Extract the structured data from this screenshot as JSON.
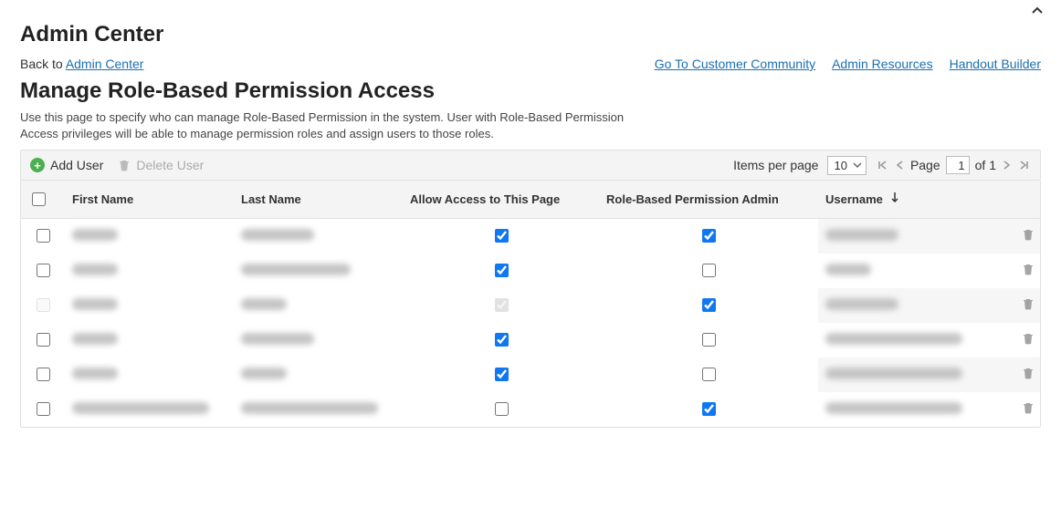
{
  "header": {
    "title": "Admin Center",
    "back_prefix": "Back to ",
    "back_link": "Admin Center"
  },
  "top_links": {
    "community": "Go To Customer Community",
    "resources": "Admin Resources",
    "handout": "Handout Builder"
  },
  "page": {
    "subtitle": "Manage Role-Based Permission Access",
    "description": "Use this page to specify who can manage Role-Based Permission in the system. User with Role-Based Permission Access privileges will be able to manage permission roles and assign users to those roles."
  },
  "toolbar": {
    "add_user": "Add User",
    "delete_user": "Delete User",
    "items_per_page_label": "Items per page",
    "items_per_page_value": "10",
    "page_label": "Page",
    "page_value": "1",
    "of_label": "of 1"
  },
  "columns": {
    "first_name": "First Name",
    "last_name": "Last Name",
    "allow_access": "Allow Access to This Page",
    "rbp_admin": "Role-Based Permission Admin",
    "username": "Username"
  },
  "rows": [
    {
      "selected": false,
      "disabled": false,
      "allow": true,
      "rbp": true,
      "fn_w": "w-sm",
      "ln_w": "w-md",
      "un_w": "w-md"
    },
    {
      "selected": false,
      "disabled": false,
      "allow": true,
      "rbp": false,
      "fn_w": "w-sm",
      "ln_w": "w-lg",
      "un_w": "w-sm"
    },
    {
      "selected": false,
      "disabled": true,
      "allow": true,
      "rbp": true,
      "fn_w": "w-sm",
      "ln_w": "w-sm",
      "un_w": "w-md"
    },
    {
      "selected": false,
      "disabled": false,
      "allow": true,
      "rbp": false,
      "fn_w": "w-sm",
      "ln_w": "w-md",
      "un_w": "w-xl"
    },
    {
      "selected": false,
      "disabled": false,
      "allow": true,
      "rbp": false,
      "fn_w": "w-sm",
      "ln_w": "w-sm",
      "un_w": "w-xl"
    },
    {
      "selected": false,
      "disabled": false,
      "allow": false,
      "rbp": true,
      "fn_w": "w-xl",
      "ln_w": "w-xl",
      "un_w": "w-xl"
    }
  ]
}
